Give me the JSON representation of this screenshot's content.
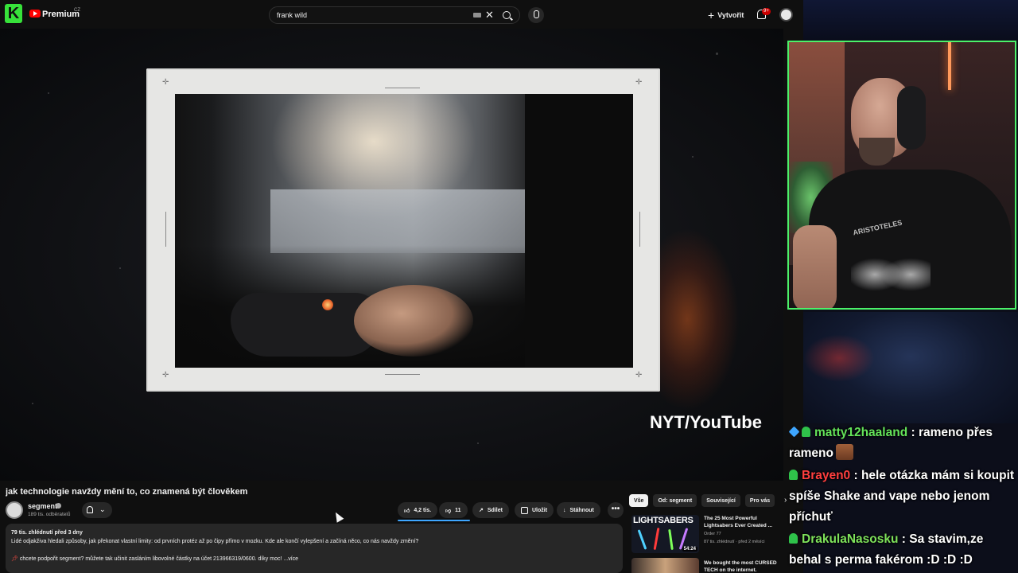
{
  "topbar": {
    "logo_letter": "K",
    "brand": "Premium",
    "country": "CZ",
    "search_value": "frank wild",
    "create_label": "Vytvořit",
    "notifications_badge": "9+",
    "icons": [
      "keyboard-icon",
      "clear-icon",
      "search-icon",
      "mic-icon",
      "bell-icon",
      "avatar"
    ]
  },
  "video": {
    "watermark": "NYT/YouTube",
    "title": "jak technologie navždy mění to, co znamená být člověkem"
  },
  "channel": {
    "name": "segment",
    "subscribers": "189 tis. odběratelů"
  },
  "actions": {
    "likes": "4,2 tis.",
    "dislikes": "11",
    "share": "Sdílet",
    "save": "Uložit",
    "download": "Stáhnout",
    "more": "•••"
  },
  "description": {
    "meta": "79 tis. zhlédnutí  před 3 dny",
    "line1": "Lidé odjakživa hledali způsoby, jak překonat vlastní limity: od prvních protéz až po čipy přímo v mozku. Kde ale končí vylepšení a začíná něco, co nás navždy změní?",
    "line2": "chcete podpořit segment? můžete tak učinit zasláním libovolné částky na účet 213966319/0600. díky moc! ",
    "more": "...více"
  },
  "chips": [
    "Vše",
    "Od: segment",
    "Související",
    "Pro vás"
  ],
  "recommendations": [
    {
      "thumb_title": "LIGHTSABERS",
      "title": "The 25 Most Powerful Lightsabers Ever Created ...",
      "channel": "Order 77",
      "meta": "87 tis. zhlédnutí · před 2 měsíci",
      "duration": "54:24"
    },
    {
      "title": "We bought the most CURSED TECH on the internet."
    }
  ],
  "chat": [
    {
      "user": "matty12haaland",
      "text": " : rameno přes rameno",
      "badges": [
        "cube-badge",
        "twitch-badge"
      ],
      "color": "#64e35a"
    },
    {
      "user": "Brayen0",
      "text": " : hele otázka mám si koupit spíše Shake and vape nebo jenom příchuť",
      "badges": [
        "twitch-badge"
      ],
      "color": "#ff3f3f"
    },
    {
      "user": "DrakulaNasosku",
      "text": " : Sa stavim,ze behal s perma fakérom :D :D :D",
      "badges": [
        "twitch-badge"
      ],
      "color": "#7ee25b"
    }
  ],
  "webcam": {
    "shirt_text": "ARISTOTELES"
  }
}
